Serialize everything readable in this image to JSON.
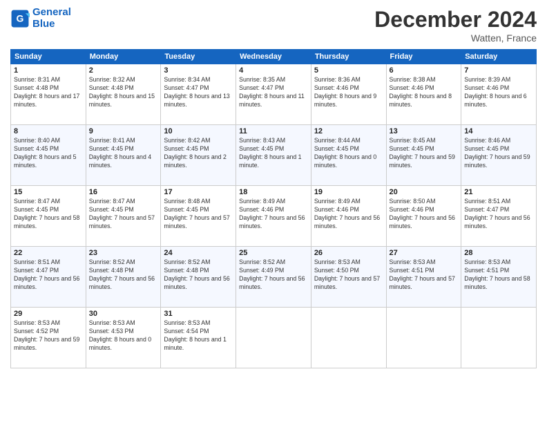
{
  "logo": {
    "line1": "General",
    "line2": "Blue"
  },
  "title": "December 2024",
  "location": "Watten, France",
  "days_header": [
    "Sunday",
    "Monday",
    "Tuesday",
    "Wednesday",
    "Thursday",
    "Friday",
    "Saturday"
  ],
  "weeks": [
    [
      {
        "day": "1",
        "sunrise": "8:31 AM",
        "sunset": "4:48 PM",
        "daylight": "8 hours and 17 minutes."
      },
      {
        "day": "2",
        "sunrise": "8:32 AM",
        "sunset": "4:48 PM",
        "daylight": "8 hours and 15 minutes."
      },
      {
        "day": "3",
        "sunrise": "8:34 AM",
        "sunset": "4:47 PM",
        "daylight": "8 hours and 13 minutes."
      },
      {
        "day": "4",
        "sunrise": "8:35 AM",
        "sunset": "4:47 PM",
        "daylight": "8 hours and 11 minutes."
      },
      {
        "day": "5",
        "sunrise": "8:36 AM",
        "sunset": "4:46 PM",
        "daylight": "8 hours and 9 minutes."
      },
      {
        "day": "6",
        "sunrise": "8:38 AM",
        "sunset": "4:46 PM",
        "daylight": "8 hours and 8 minutes."
      },
      {
        "day": "7",
        "sunrise": "8:39 AM",
        "sunset": "4:46 PM",
        "daylight": "8 hours and 6 minutes."
      }
    ],
    [
      {
        "day": "8",
        "sunrise": "8:40 AM",
        "sunset": "4:45 PM",
        "daylight": "8 hours and 5 minutes."
      },
      {
        "day": "9",
        "sunrise": "8:41 AM",
        "sunset": "4:45 PM",
        "daylight": "8 hours and 4 minutes."
      },
      {
        "day": "10",
        "sunrise": "8:42 AM",
        "sunset": "4:45 PM",
        "daylight": "8 hours and 2 minutes."
      },
      {
        "day": "11",
        "sunrise": "8:43 AM",
        "sunset": "4:45 PM",
        "daylight": "8 hours and 1 minute."
      },
      {
        "day": "12",
        "sunrise": "8:44 AM",
        "sunset": "4:45 PM",
        "daylight": "8 hours and 0 minutes."
      },
      {
        "day": "13",
        "sunrise": "8:45 AM",
        "sunset": "4:45 PM",
        "daylight": "7 hours and 59 minutes."
      },
      {
        "day": "14",
        "sunrise": "8:46 AM",
        "sunset": "4:45 PM",
        "daylight": "7 hours and 59 minutes."
      }
    ],
    [
      {
        "day": "15",
        "sunrise": "8:47 AM",
        "sunset": "4:45 PM",
        "daylight": "7 hours and 58 minutes."
      },
      {
        "day": "16",
        "sunrise": "8:47 AM",
        "sunset": "4:45 PM",
        "daylight": "7 hours and 57 minutes."
      },
      {
        "day": "17",
        "sunrise": "8:48 AM",
        "sunset": "4:45 PM",
        "daylight": "7 hours and 57 minutes."
      },
      {
        "day": "18",
        "sunrise": "8:49 AM",
        "sunset": "4:46 PM",
        "daylight": "7 hours and 56 minutes."
      },
      {
        "day": "19",
        "sunrise": "8:49 AM",
        "sunset": "4:46 PM",
        "daylight": "7 hours and 56 minutes."
      },
      {
        "day": "20",
        "sunrise": "8:50 AM",
        "sunset": "4:46 PM",
        "daylight": "7 hours and 56 minutes."
      },
      {
        "day": "21",
        "sunrise": "8:51 AM",
        "sunset": "4:47 PM",
        "daylight": "7 hours and 56 minutes."
      }
    ],
    [
      {
        "day": "22",
        "sunrise": "8:51 AM",
        "sunset": "4:47 PM",
        "daylight": "7 hours and 56 minutes."
      },
      {
        "day": "23",
        "sunrise": "8:52 AM",
        "sunset": "4:48 PM",
        "daylight": "7 hours and 56 minutes."
      },
      {
        "day": "24",
        "sunrise": "8:52 AM",
        "sunset": "4:48 PM",
        "daylight": "7 hours and 56 minutes."
      },
      {
        "day": "25",
        "sunrise": "8:52 AM",
        "sunset": "4:49 PM",
        "daylight": "7 hours and 56 minutes."
      },
      {
        "day": "26",
        "sunrise": "8:53 AM",
        "sunset": "4:50 PM",
        "daylight": "7 hours and 57 minutes."
      },
      {
        "day": "27",
        "sunrise": "8:53 AM",
        "sunset": "4:51 PM",
        "daylight": "7 hours and 57 minutes."
      },
      {
        "day": "28",
        "sunrise": "8:53 AM",
        "sunset": "4:51 PM",
        "daylight": "7 hours and 58 minutes."
      }
    ],
    [
      {
        "day": "29",
        "sunrise": "8:53 AM",
        "sunset": "4:52 PM",
        "daylight": "7 hours and 59 minutes."
      },
      {
        "day": "30",
        "sunrise": "8:53 AM",
        "sunset": "4:53 PM",
        "daylight": "8 hours and 0 minutes."
      },
      {
        "day": "31",
        "sunrise": "8:53 AM",
        "sunset": "4:54 PM",
        "daylight": "8 hours and 1 minute."
      },
      null,
      null,
      null,
      null
    ]
  ],
  "labels": {
    "sunrise": "Sunrise:",
    "sunset": "Sunset:",
    "daylight": "Daylight:"
  }
}
